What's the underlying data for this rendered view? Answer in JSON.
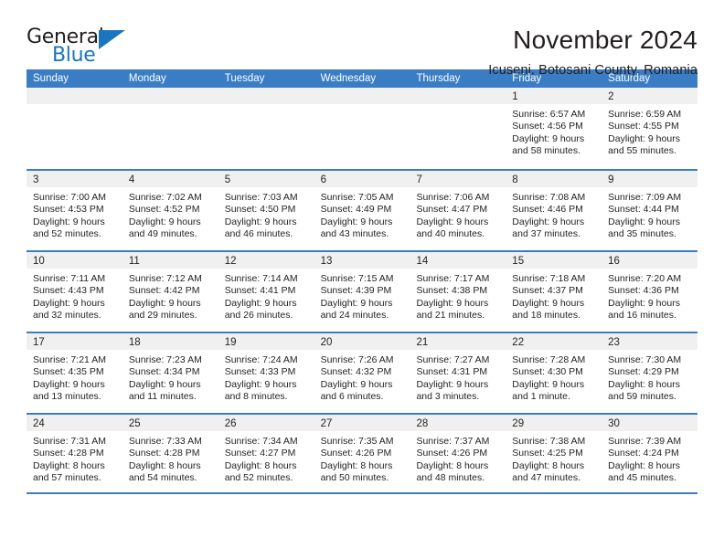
{
  "logo": {
    "word_top": "General",
    "word_bottom": "Blue",
    "triangle_color": "#1b75bc"
  },
  "header": {
    "title": "November 2024",
    "subtitle": "Icuseni, Botosani County, Romania"
  },
  "theme": {
    "header_blue": "#3b7dc4",
    "day_band_gray": "#f0f0f0",
    "text": "#231f20"
  },
  "weekdays": [
    "Sunday",
    "Monday",
    "Tuesday",
    "Wednesday",
    "Thursday",
    "Friday",
    "Saturday"
  ],
  "weeks": [
    [
      {
        "date": "",
        "lines": []
      },
      {
        "date": "",
        "lines": []
      },
      {
        "date": "",
        "lines": []
      },
      {
        "date": "",
        "lines": []
      },
      {
        "date": "",
        "lines": []
      },
      {
        "date": "1",
        "lines": [
          "Sunrise: 6:57 AM",
          "Sunset: 4:56 PM",
          "Daylight: 9 hours",
          "and 58 minutes."
        ]
      },
      {
        "date": "2",
        "lines": [
          "Sunrise: 6:59 AM",
          "Sunset: 4:55 PM",
          "Daylight: 9 hours",
          "and 55 minutes."
        ]
      }
    ],
    [
      {
        "date": "3",
        "lines": [
          "Sunrise: 7:00 AM",
          "Sunset: 4:53 PM",
          "Daylight: 9 hours",
          "and 52 minutes."
        ]
      },
      {
        "date": "4",
        "lines": [
          "Sunrise: 7:02 AM",
          "Sunset: 4:52 PM",
          "Daylight: 9 hours",
          "and 49 minutes."
        ]
      },
      {
        "date": "5",
        "lines": [
          "Sunrise: 7:03 AM",
          "Sunset: 4:50 PM",
          "Daylight: 9 hours",
          "and 46 minutes."
        ]
      },
      {
        "date": "6",
        "lines": [
          "Sunrise: 7:05 AM",
          "Sunset: 4:49 PM",
          "Daylight: 9 hours",
          "and 43 minutes."
        ]
      },
      {
        "date": "7",
        "lines": [
          "Sunrise: 7:06 AM",
          "Sunset: 4:47 PM",
          "Daylight: 9 hours",
          "and 40 minutes."
        ]
      },
      {
        "date": "8",
        "lines": [
          "Sunrise: 7:08 AM",
          "Sunset: 4:46 PM",
          "Daylight: 9 hours",
          "and 37 minutes."
        ]
      },
      {
        "date": "9",
        "lines": [
          "Sunrise: 7:09 AM",
          "Sunset: 4:44 PM",
          "Daylight: 9 hours",
          "and 35 minutes."
        ]
      }
    ],
    [
      {
        "date": "10",
        "lines": [
          "Sunrise: 7:11 AM",
          "Sunset: 4:43 PM",
          "Daylight: 9 hours",
          "and 32 minutes."
        ]
      },
      {
        "date": "11",
        "lines": [
          "Sunrise: 7:12 AM",
          "Sunset: 4:42 PM",
          "Daylight: 9 hours",
          "and 29 minutes."
        ]
      },
      {
        "date": "12",
        "lines": [
          "Sunrise: 7:14 AM",
          "Sunset: 4:41 PM",
          "Daylight: 9 hours",
          "and 26 minutes."
        ]
      },
      {
        "date": "13",
        "lines": [
          "Sunrise: 7:15 AM",
          "Sunset: 4:39 PM",
          "Daylight: 9 hours",
          "and 24 minutes."
        ]
      },
      {
        "date": "14",
        "lines": [
          "Sunrise: 7:17 AM",
          "Sunset: 4:38 PM",
          "Daylight: 9 hours",
          "and 21 minutes."
        ]
      },
      {
        "date": "15",
        "lines": [
          "Sunrise: 7:18 AM",
          "Sunset: 4:37 PM",
          "Daylight: 9 hours",
          "and 18 minutes."
        ]
      },
      {
        "date": "16",
        "lines": [
          "Sunrise: 7:20 AM",
          "Sunset: 4:36 PM",
          "Daylight: 9 hours",
          "and 16 minutes."
        ]
      }
    ],
    [
      {
        "date": "17",
        "lines": [
          "Sunrise: 7:21 AM",
          "Sunset: 4:35 PM",
          "Daylight: 9 hours",
          "and 13 minutes."
        ]
      },
      {
        "date": "18",
        "lines": [
          "Sunrise: 7:23 AM",
          "Sunset: 4:34 PM",
          "Daylight: 9 hours",
          "and 11 minutes."
        ]
      },
      {
        "date": "19",
        "lines": [
          "Sunrise: 7:24 AM",
          "Sunset: 4:33 PM",
          "Daylight: 9 hours",
          "and 8 minutes."
        ]
      },
      {
        "date": "20",
        "lines": [
          "Sunrise: 7:26 AM",
          "Sunset: 4:32 PM",
          "Daylight: 9 hours",
          "and 6 minutes."
        ]
      },
      {
        "date": "21",
        "lines": [
          "Sunrise: 7:27 AM",
          "Sunset: 4:31 PM",
          "Daylight: 9 hours",
          "and 3 minutes."
        ]
      },
      {
        "date": "22",
        "lines": [
          "Sunrise: 7:28 AM",
          "Sunset: 4:30 PM",
          "Daylight: 9 hours",
          "and 1 minute."
        ]
      },
      {
        "date": "23",
        "lines": [
          "Sunrise: 7:30 AM",
          "Sunset: 4:29 PM",
          "Daylight: 8 hours",
          "and 59 minutes."
        ]
      }
    ],
    [
      {
        "date": "24",
        "lines": [
          "Sunrise: 7:31 AM",
          "Sunset: 4:28 PM",
          "Daylight: 8 hours",
          "and 57 minutes."
        ]
      },
      {
        "date": "25",
        "lines": [
          "Sunrise: 7:33 AM",
          "Sunset: 4:28 PM",
          "Daylight: 8 hours",
          "and 54 minutes."
        ]
      },
      {
        "date": "26",
        "lines": [
          "Sunrise: 7:34 AM",
          "Sunset: 4:27 PM",
          "Daylight: 8 hours",
          "and 52 minutes."
        ]
      },
      {
        "date": "27",
        "lines": [
          "Sunrise: 7:35 AM",
          "Sunset: 4:26 PM",
          "Daylight: 8 hours",
          "and 50 minutes."
        ]
      },
      {
        "date": "28",
        "lines": [
          "Sunrise: 7:37 AM",
          "Sunset: 4:26 PM",
          "Daylight: 8 hours",
          "and 48 minutes."
        ]
      },
      {
        "date": "29",
        "lines": [
          "Sunrise: 7:38 AM",
          "Sunset: 4:25 PM",
          "Daylight: 8 hours",
          "and 47 minutes."
        ]
      },
      {
        "date": "30",
        "lines": [
          "Sunrise: 7:39 AM",
          "Sunset: 4:24 PM",
          "Daylight: 8 hours",
          "and 45 minutes."
        ]
      }
    ]
  ]
}
